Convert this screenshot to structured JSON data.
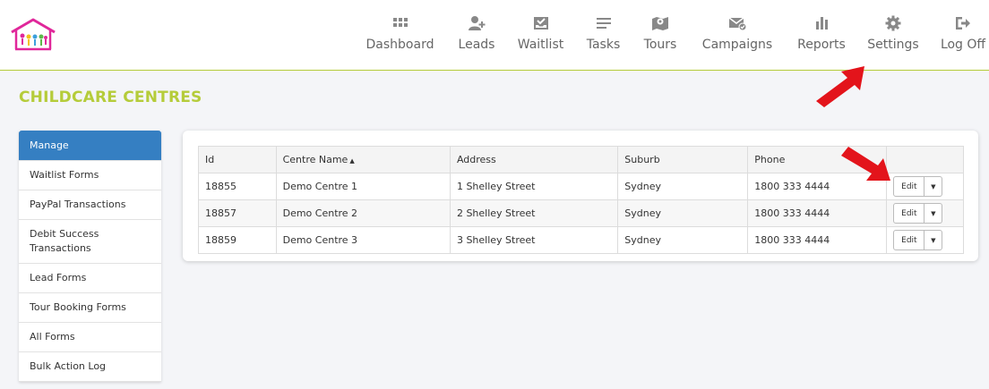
{
  "nav": {
    "items": [
      {
        "label": "Dashboard",
        "icon": "grid-icon"
      },
      {
        "label": "Leads",
        "icon": "add-user-icon"
      },
      {
        "label": "Waitlist",
        "icon": "inbox-check-icon"
      },
      {
        "label": "Tasks",
        "icon": "list-icon"
      },
      {
        "label": "Tours",
        "icon": "map-pin-icon"
      },
      {
        "label": "Campaigns",
        "icon": "mail-check-icon"
      },
      {
        "label": "Reports",
        "icon": "bar-chart-icon"
      },
      {
        "label": "Settings",
        "icon": "gear-icon"
      },
      {
        "label": "Log Off",
        "icon": "logout-icon"
      }
    ]
  },
  "page": {
    "title": "CHILDCARE CENTRES"
  },
  "sidebar": {
    "items": [
      {
        "label": "Manage"
      },
      {
        "label": "Waitlist Forms"
      },
      {
        "label": "PayPal Transactions"
      },
      {
        "label": "Debit Success Transactions"
      },
      {
        "label": "Lead Forms"
      },
      {
        "label": "Tour Booking Forms"
      },
      {
        "label": "All Forms"
      },
      {
        "label": "Bulk Action Log"
      }
    ]
  },
  "table": {
    "columns": [
      "Id",
      "Centre Name",
      "Address",
      "Suburb",
      "Phone",
      ""
    ],
    "rows": [
      {
        "id": "18855",
        "name": "Demo Centre 1",
        "address": "1 Shelley Street",
        "suburb": "Sydney",
        "phone": "1800 333 4444"
      },
      {
        "id": "18857",
        "name": "Demo Centre 2",
        "address": "2 Shelley Street",
        "suburb": "Sydney",
        "phone": "1800 333 4444"
      },
      {
        "id": "18859",
        "name": "Demo Centre 3",
        "address": "3 Shelley Street",
        "suburb": "Sydney",
        "phone": "1800 333 4444"
      }
    ],
    "edit_label": "Edit",
    "sort_indicator": "▲",
    "caret": "▼"
  },
  "colors": {
    "accent": "#b5cc3a",
    "primary": "#357fc2",
    "arrow": "#e3141b",
    "logo": "#e0279a"
  }
}
